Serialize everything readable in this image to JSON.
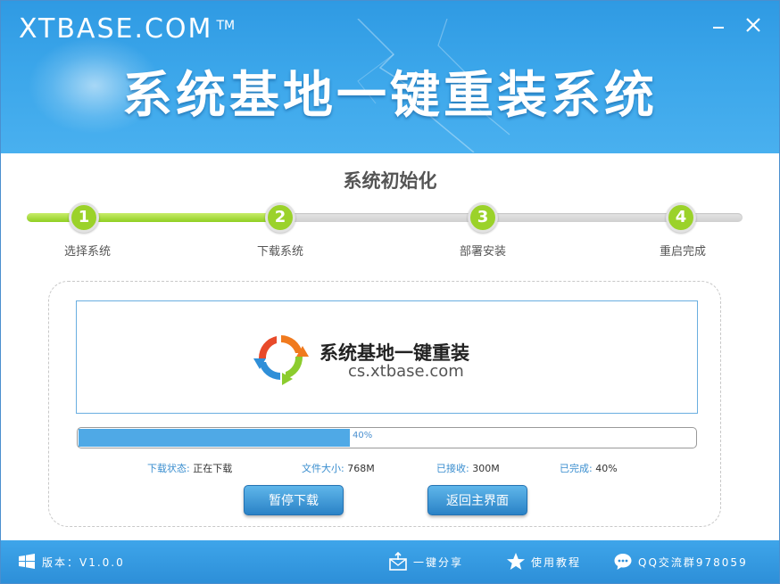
{
  "window": {
    "brand": "XTBASE.COM",
    "brand_tm": "TM",
    "hero_title": "系统基地一键重装系统"
  },
  "wizard": {
    "title": "系统初始化",
    "progress_fraction": 0.355,
    "steps": [
      {
        "number": "1",
        "label": "选择系统"
      },
      {
        "number": "2",
        "label": "下载系统"
      },
      {
        "number": "3",
        "label": "部署安装"
      },
      {
        "number": "4",
        "label": "重启完成"
      }
    ]
  },
  "banner": {
    "logo_title": "系统基地一键重装",
    "logo_url": "cs.xtbase.com"
  },
  "download": {
    "progress_percent": 40,
    "progress_text": "40%",
    "status_label": "下载状态:",
    "status_value": "正在下载",
    "size_label": "文件大小:",
    "size_value": "768M",
    "received_label": "已接收:",
    "received_value": "300M",
    "done_label": "已完成:",
    "done_value": "40%"
  },
  "buttons": {
    "pause": "暂停下载",
    "home": "返回主界面"
  },
  "footer": {
    "version": "版本：V1.0.0",
    "share": "一键分享",
    "tutorial": "使用教程",
    "qq_group": "QQ交流群978059"
  },
  "colors": {
    "header_blue": "#3ba6ea",
    "step_green": "#9bd22a",
    "progress_blue": "#4fa9e6",
    "button_blue": "#2a82c6"
  },
  "icons": [
    "minimize-icon",
    "close-icon",
    "windows-icon",
    "share-icon",
    "star-icon",
    "chat-icon"
  ]
}
